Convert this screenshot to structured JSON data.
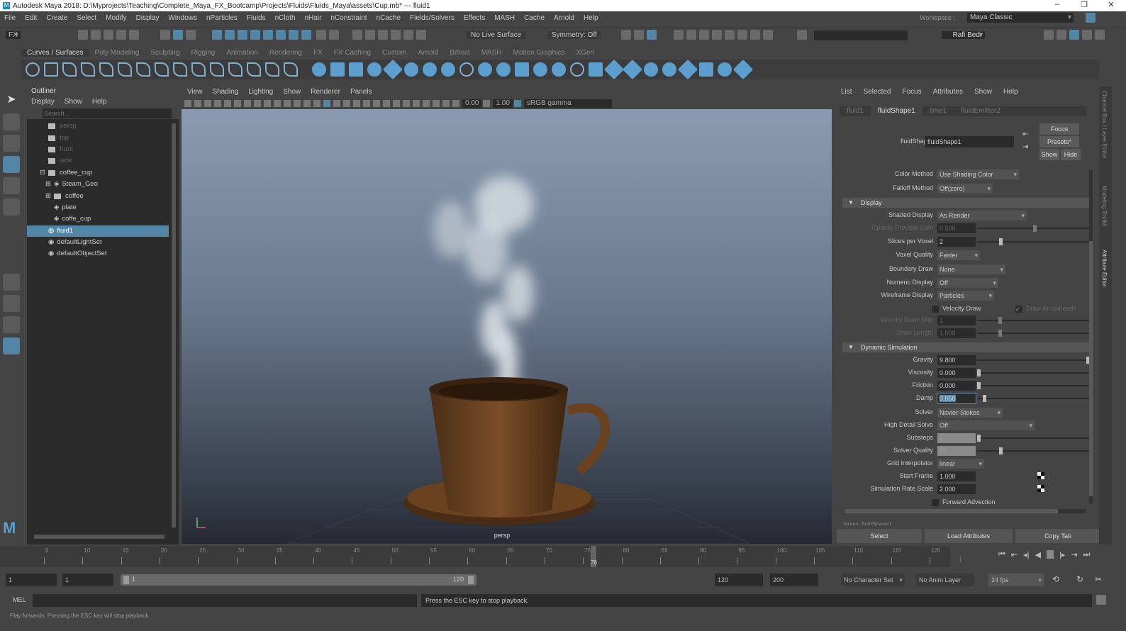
{
  "window": {
    "title": "Autodesk Maya 2018: D:\\Myprojects\\Teaching\\Complete_Maya_FX_Bootcamp\\Projects\\Fluids\\Fluids_Maya\\assets\\Cup.mb*  ---  fluid1",
    "minimize": "–",
    "maximize": "❐",
    "close": "✕"
  },
  "menubar": [
    "File",
    "Edit",
    "Create",
    "Select",
    "Modify",
    "Display",
    "Windows",
    "nParticles",
    "Fluids",
    "nCloth",
    "nHair",
    "nConstraint",
    "nCache",
    "Fields/Solvers",
    "Effects",
    "MASH",
    "Cache",
    "Arnold",
    "Help"
  ],
  "workspace": {
    "label": "Workspace :",
    "value": "Maya Classic"
  },
  "statusline": {
    "menuset": "FX",
    "live_surface": "No Live Surface",
    "symmetry": "Symmetry: Off",
    "user": "Rafi Bedr"
  },
  "shelf_tabs": [
    "Curves / Surfaces",
    "Poly Modeling",
    "Sculpting",
    "Rigging",
    "Animation",
    "Rendering",
    "FX",
    "FX Caching",
    "Custom",
    "Arnold",
    "Bifrost",
    "MASH",
    "Motion Graphics",
    "XGen"
  ],
  "outliner": {
    "title": "Outliner",
    "menu": [
      "Display",
      "Show",
      "Help"
    ],
    "search_placeholder": "Search...",
    "items": [
      {
        "label": "persp",
        "dim": true
      },
      {
        "label": "top",
        "dim": true
      },
      {
        "label": "front",
        "dim": true
      },
      {
        "label": "side",
        "dim": true
      },
      {
        "label": "coffee_cup"
      },
      {
        "label": "Steam_Geo"
      },
      {
        "label": "coffee"
      },
      {
        "label": "plate"
      },
      {
        "label": "coffe_cup"
      },
      {
        "label": "fluid1",
        "selected": true
      },
      {
        "label": "defaultLightSet"
      },
      {
        "label": "defaultObjectSet"
      }
    ]
  },
  "viewport": {
    "menu": [
      "View",
      "Shading",
      "Lighting",
      "Show",
      "Renderer",
      "Panels"
    ],
    "exposure": "0.00",
    "gamma": "1.00",
    "colorspace": "sRGB gamma",
    "camera_label": "persp"
  },
  "attribute_editor": {
    "menu": [
      "List",
      "Selected",
      "Focus",
      "Attributes",
      "Show",
      "Help"
    ],
    "tabs": [
      "fluid1",
      "fluidShape1",
      "time1",
      "fluidEmitter2"
    ],
    "active_tab": "fluidShape1",
    "node_label": "fluidShape:",
    "node_value": "fluidShape1",
    "focus": "Focus",
    "presets": "Presets*",
    "show": "Show",
    "hide": "Hide",
    "color_method": {
      "label": "Color Method",
      "value": "Use Shading Color"
    },
    "falloff_method": {
      "label": "Falloff Method",
      "value": "Off(zero)"
    },
    "display_section": "Display",
    "shaded_display": {
      "label": "Shaded Display",
      "value": "As Render"
    },
    "opacity_preview_gain": {
      "label": "Opacity Preview Gain",
      "value": "0.500",
      "slider": 0.5
    },
    "slices_per_voxel": {
      "label": "Slices per Voxel",
      "value": "2",
      "slider": 0.2
    },
    "voxel_quality": {
      "label": "Voxel Quality",
      "value": "Faster"
    },
    "boundary_draw": {
      "label": "Boundary Draw",
      "value": "None"
    },
    "numeric_display": {
      "label": "Numeric Display",
      "value": "Off"
    },
    "wireframe_display": {
      "label": "Wireframe Display",
      "value": "Particles"
    },
    "velocity_draw": {
      "label": "Velocity Draw",
      "checked": false
    },
    "draw_arrowheads": {
      "label": "Draw Arrowheads",
      "checked": true
    },
    "velocity_draw_skip": {
      "label": "Velocity Draw Skip",
      "value": "1"
    },
    "draw_length": {
      "label": "Draw Length",
      "value": "1.000"
    },
    "dynamic_section": "Dynamic Simulation",
    "gravity": {
      "label": "Gravity",
      "value": "9.800",
      "slider": 0.98
    },
    "viscosity": {
      "label": "Viscosity",
      "value": "0.000",
      "slider": 0
    },
    "friction": {
      "label": "Friction",
      "value": "0.000",
      "slider": 0
    },
    "damp": {
      "label": "Damp",
      "value": "0.050",
      "slider": 0.05
    },
    "solver": {
      "label": "Solver",
      "value": "Navier-Stokes"
    },
    "high_detail_solve": {
      "label": "High Detail Solve",
      "value": "Off"
    },
    "substeps": {
      "label": "Substeps",
      "value": "1"
    },
    "solver_quality": {
      "label": "Solver Quality",
      "value": "20",
      "slider": 0.2
    },
    "grid_interpolator": {
      "label": "Grid Interpolator",
      "value": "linear"
    },
    "start_frame": {
      "label": "Start Frame",
      "value": "1.000"
    },
    "simulation_rate_scale": {
      "label": "Simulation Rate Scale",
      "value": "2.000"
    },
    "forward_advection": {
      "label": "Forward Advection",
      "checked": false
    },
    "notes": "Notes: fluidShape1",
    "select": "Select",
    "load_attributes": "Load Attributes",
    "copy_tab": "Copy Tab"
  },
  "side_tabs": [
    "Channel Box / Layer Editor",
    "Modeling Toolkit",
    "Attribute Editor"
  ],
  "timeline": {
    "ticks": [
      "5",
      "10",
      "15",
      "20",
      "25",
      "30",
      "35",
      "40",
      "45",
      "50",
      "55",
      "60",
      "65",
      "70",
      "75",
      "80",
      "85",
      "90",
      "95",
      "100",
      "105",
      "110",
      "115",
      "120"
    ],
    "current_frame": "76",
    "end_label": "1"
  },
  "range": {
    "start": "1",
    "playback_start": "1",
    "slider_start": "1",
    "slider_end": "120",
    "playback_end": "120",
    "end": "200",
    "character_set": "No Character Set",
    "anim_layer": "No Anim Layer",
    "fps": "24 fps"
  },
  "command": {
    "label": "MEL",
    "result": "Press the ESC key to stop playback."
  },
  "help_line": "Play forwards. Pressing the ESC key will stop playback."
}
